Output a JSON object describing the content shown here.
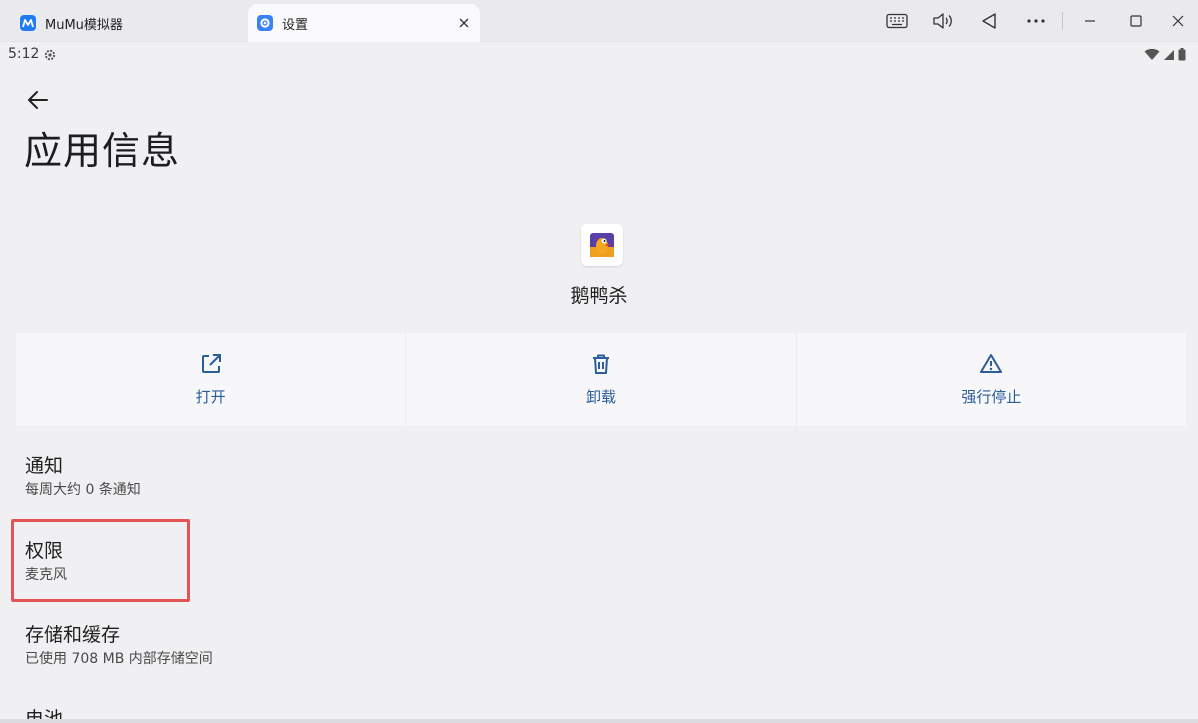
{
  "window": {
    "tabs": [
      {
        "label": "MuMu模拟器",
        "icon": "mumu-logo-icon",
        "active": false
      },
      {
        "label": "设置",
        "icon": "settings-gear-icon",
        "active": true
      }
    ]
  },
  "status_bar": {
    "time": "5:12"
  },
  "header": {
    "title": "应用信息"
  },
  "app": {
    "name": "鹅鸭杀"
  },
  "actions": [
    {
      "label": "打开",
      "icon": "open-external-icon"
    },
    {
      "label": "卸载",
      "icon": "trash-icon"
    },
    {
      "label": "强行停止",
      "icon": "warning-icon"
    }
  ],
  "prefs": [
    {
      "title": "通知",
      "summary": "每周大约 0 条通知"
    },
    {
      "title": "权限",
      "summary": "麦克风"
    },
    {
      "title": "存储和缓存",
      "summary": "已使用 708 MB 内部存储空间"
    },
    {
      "title": "电池",
      "summary": ""
    }
  ],
  "colors": {
    "accent": "#2b5d99",
    "highlight": "#e35555",
    "background": "#f0f0f3"
  }
}
